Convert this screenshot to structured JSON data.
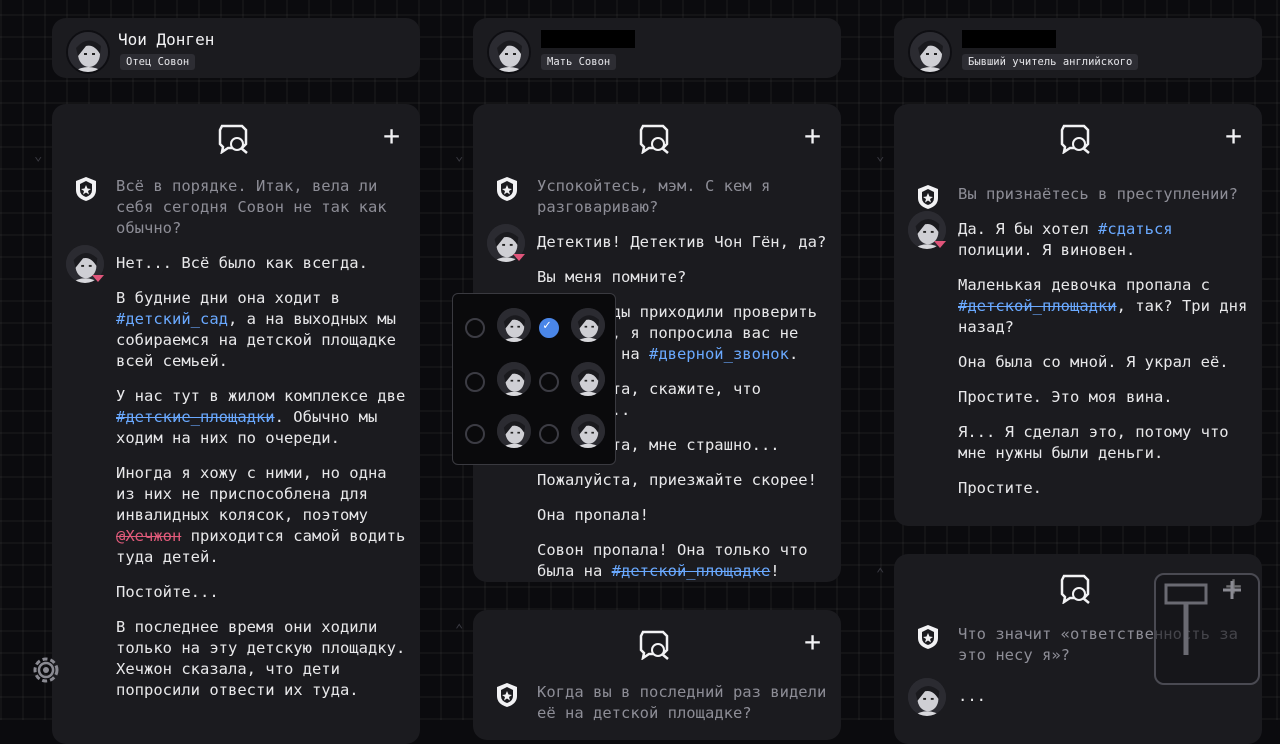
{
  "columns": [
    {
      "name": "Чои Донген",
      "role": "Отец Совон",
      "messages": [
        {
          "who": "detective",
          "text": "Всё в порядке. Итак, вела ли себя сегодня Совон не так как обычно?"
        },
        {
          "who": "suspect",
          "paras": [
            "Нет... Всё было как всегда."
          ]
        }
      ],
      "p2a": "В будние дни она ходит в ",
      "p2tag": "#детский_сад",
      "p2b": ", а на выходных мы собираемся на детской площадке всей семьей.",
      "p3a": "У нас тут в жилом комплексе две ",
      "p3tag": "#детские_площадки",
      "p3b": ". Обычно мы ходим на них по очереди.",
      "p4a": "Иногда я хожу с ними, но одна из них не приспособлена для инвалидных колясок, поэтому ",
      "p4mention": "@Хечжон",
      "p4b": " приходится самой водить туда детей.",
      "p5": "Постойте...",
      "p6": "В последнее время они ходили только на эту детскую площадку. Хечжон сказала, что дети попросили отвести их туда."
    },
    {
      "role": "Мать Совон",
      "q1": "Успокойтесь, мэм. С кем я разговариваю?",
      "a1": "Детектив! Детектив Чон Гён, да?",
      "a2": "Вы меня помните?",
      "a3a": "Вы однажды приходили проверить ",
      "a3b": "квартиру, я попросила вас не ",
      "a3c": "нажимать на ",
      "a3tag": "#дверной_звонок",
      "a3d": ".",
      "a4": "Пожалуйста, скажите, что помните...",
      "a5": "Пожалуйста, мне страшно...",
      "a6": "Пожалуйста, приезжайте скорее!",
      "a7": "Она пропала!",
      "a8a": "Совон пропала! Она только что была на ",
      "a8tag": "#детской_площадке",
      "a8b": "!",
      "q2": "Когда вы в последний раз видели её на детской площадке?"
    },
    {
      "role": "Бывший учитель английского",
      "q1": "Вы признаётесь в преступлении?",
      "a1a": "Да. Я бы хотел ",
      "a1tag": "#сдаться",
      "a1b": " полиции. Я виновен.",
      "a2a": "Маленькая девочка пропала с ",
      "a2tag": "#детской_площадки",
      "a2b": ", так? Три дня назад?",
      "a3": "Она была со мной. Я украл её.",
      "a4": "Простите. Это моя вина.",
      "a5": "Я... Я сделал это, потому что мне нужны были деньги.",
      "a6": "Простите.",
      "q2": "Что значит «ответственность за это несу я»?",
      "a7": "..."
    }
  ],
  "icons": {
    "add": "+",
    "new_chat": "chat-bubble-icon",
    "settings": "gear-icon",
    "detective": "police-badge-icon"
  },
  "colors": {
    "accent": "#6aa9ff",
    "mention": "#e05a7a",
    "panel": "#1b1b1f",
    "bg": "#0b0b0e",
    "muted": "#8d8d96"
  }
}
